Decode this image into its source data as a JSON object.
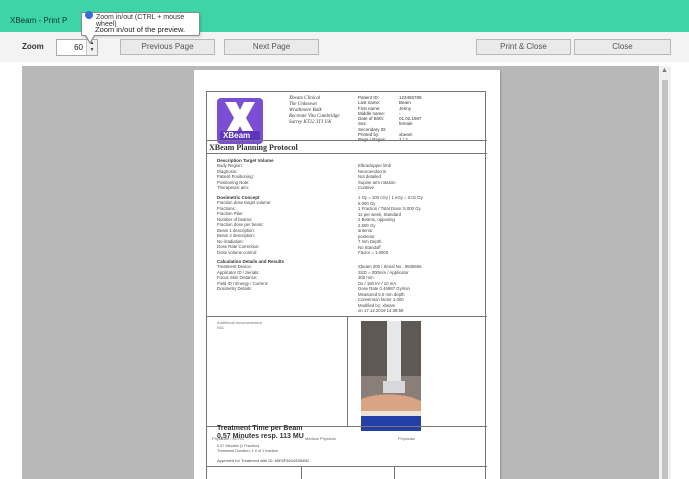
{
  "window": {
    "title": "XBeam - Print P"
  },
  "tooltip": {
    "title": "Zoom in/out (CTRL + mouse wheel)",
    "text": "Zoom in/out of the preview."
  },
  "toolbar": {
    "zoom_label": "Zoom",
    "zoom_value": "60",
    "previous_page": "Previous Page",
    "next_page": "Next Page",
    "print_close": "Print & Close",
    "close": "Close"
  },
  "colors": {
    "titlebar": "#3dd4a8",
    "logo": "#7b4fd4",
    "viewport": "#b8b8b8"
  },
  "report": {
    "logo_text": "XBeam",
    "clinic": {
      "name": "Xbeam Clinical",
      "line1": "The Unknown",
      "line2": "Wrathmore Balk",
      "line3": "Recreate Vita Cambridge",
      "line4": "Surrey KT22 3TJ UK"
    },
    "patient": [
      {
        "key": "Patient ID:",
        "value": "123456789"
      },
      {
        "key": "Last name:",
        "value": "Beam"
      },
      {
        "key": "First name:",
        "value": "Jenny"
      },
      {
        "key": "Middle name:",
        "value": "-"
      },
      {
        "key": "Date of Birth:",
        "value": "01.02.1987"
      },
      {
        "key": "Sex:",
        "value": "female"
      },
      {
        "key": "Secondary ID:",
        "value": ""
      },
      {
        "key": "Printed by:",
        "value": "xbeam"
      },
      {
        "key": "Page / Pages:",
        "value": "1 / 2"
      }
    ],
    "title": "XBeam Planning Protocol",
    "sections": {
      "target_h": "Description Target Volume",
      "target_labels": [
        "Body Region:",
        "Diagnosis:",
        "Patient Positioning:",
        "Positioning Note:",
        "Therapeutic aim:"
      ],
      "target_values": [
        "Elbow/upper limb",
        "Neuroendocrin",
        "Not detailed",
        "Supine arm rotation",
        "Curative"
      ],
      "beam_h": "Dosimetric Concept",
      "beam_labels": [
        "Fraction dose target volume:",
        "Fractions:",
        "Fraction Plan:",
        "Number of beams:",
        "Fraction dose per beam:",
        "Beam 1 description:",
        "Beam 2 description:",
        "No irradiation:",
        "Dose Rate Correction:",
        "Dose volume control:"
      ],
      "beam_values": [
        "1 Gy = 100 cGy | 1 eGy = 0.01 Gy",
        "5.000 Gy",
        "1 Fraction / Total Dose: 5.000 Gy",
        "1x per week, Standard",
        "2 Beams, opposing",
        "2.500 Gy",
        "anterior",
        "posterior",
        "7 mm Depth",
        "No Standoff",
        "Factor = 1.0000"
      ],
      "calc_h": "Calculation Details and Results",
      "calc_labels": [
        "Treatment Device:",
        "Applicator ID / Serials:",
        "Focus Skin Distance:",
        "Field ID / Energy / Current:",
        "Dosimetry Details:"
      ],
      "calc_values": [
        "Xbeam 300 / Serial No.: 9845566",
        "SSD = 300mm / Applicator",
        "300 mm",
        "Dx / 150 kV / 10 mA",
        "Dose Rate 0.46987 Gy/min",
        "Measured 5.0 mm depth",
        "Conversion factor 1.000",
        "Modified by: xbeam",
        "on 17.12.2019 14:38:58"
      ]
    },
    "additional_doc_label": "Additional documentation",
    "additional_doc_value": "N/A",
    "treatment_time_h1": "Treatment Time per Beam",
    "treatment_time_h2": "0,57 Minutes resp. 113 MU",
    "treatment_note1": "0.57 Minutes (1 Fraction)",
    "treatment_note2": "Treatment Duration: 1.0 of 1 fraction",
    "approved": "Approved for Treatment with ID: 65F8F460433B4B2",
    "signatures": [
      "Physician / MTRA",
      "Medical Physicist",
      "Physician"
    ]
  }
}
